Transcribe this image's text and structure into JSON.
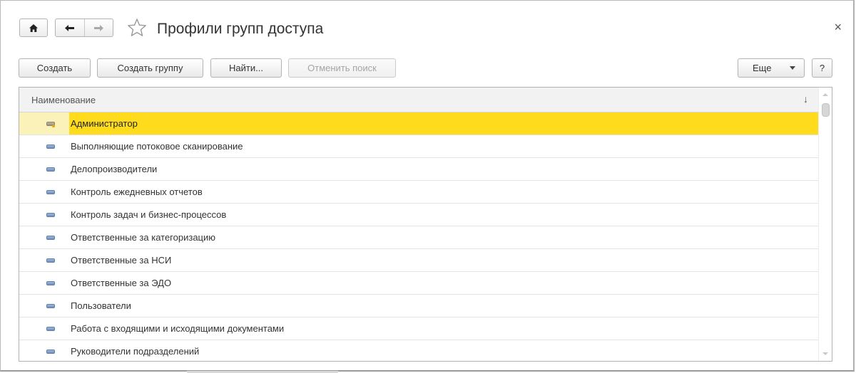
{
  "window": {
    "title": "Профили групп доступа",
    "close_glyph": "×"
  },
  "nav": {
    "home_icon": "home-icon",
    "back_icon": "arrow-left-icon",
    "forward_icon": "arrow-right-icon",
    "favorite_icon": "star-outline-icon"
  },
  "toolbar": {
    "create_label": "Создать",
    "create_group_label": "Создать группу",
    "find_label": "Найти...",
    "cancel_search_label": "Отменить поиск",
    "more_label": "Еще",
    "help_label": "?"
  },
  "table": {
    "column_header": "Наименование",
    "sort_glyph": "↓",
    "rows": [
      {
        "label": "Администратор",
        "selected": true
      },
      {
        "label": "Выполняющие потоковое сканирование"
      },
      {
        "label": "Делопроизводители"
      },
      {
        "label": "Контроль ежедневных отчетов"
      },
      {
        "label": "Контроль задач и бизнес-процессов"
      },
      {
        "label": "Ответственные за категоризацию"
      },
      {
        "label": "Ответственные за НСИ"
      },
      {
        "label": "Ответственные за ЭДО"
      },
      {
        "label": "Пользователи"
      },
      {
        "label": "Работа с входящими и исходящими документами"
      },
      {
        "label": "Руководители подразделений"
      }
    ]
  },
  "colors": {
    "selection": "#fedc1d",
    "selection_icon_cell": "#fbf2b9"
  }
}
